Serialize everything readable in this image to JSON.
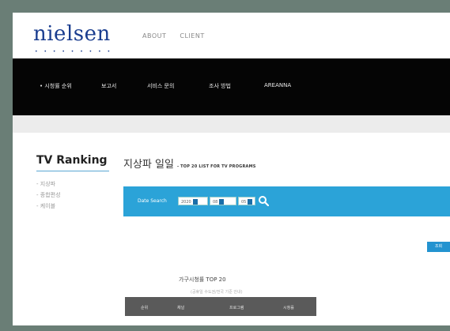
{
  "header": {
    "logo": "nielsen",
    "logo_dots": "• • • • • • • • •",
    "nav": [
      "ABOUT",
      "CLIENT"
    ]
  },
  "main_nav": [
    {
      "label": "• 시청률 순위"
    },
    {
      "label": "보고서"
    },
    {
      "label": "서비스 문의"
    },
    {
      "label": "조사 방법"
    },
    {
      "label": "AREANNA"
    }
  ],
  "sidebar": {
    "title": "TV Ranking",
    "items": [
      "- 지상파",
      "- 종합편성",
      "- 케이블"
    ]
  },
  "content": {
    "title": "지상파 일일",
    "subtitle": "- TOP 20 LIST FOR TV PROGRAMS"
  },
  "search": {
    "label": "Date Search",
    "year": "2020",
    "month": "08",
    "day": "05"
  },
  "button_label": "조회",
  "table": {
    "title": "가구시청률 TOP 20",
    "note": "(공휴일 수도권/전국 기준 안내)",
    "columns": [
      "순위",
      "채널",
      "프로그램",
      "시청률"
    ]
  },
  "colors": {
    "nav_bg": "#050505",
    "accent_blue": "#2ba3d8",
    "logo_blue": "#1a3d8f"
  }
}
